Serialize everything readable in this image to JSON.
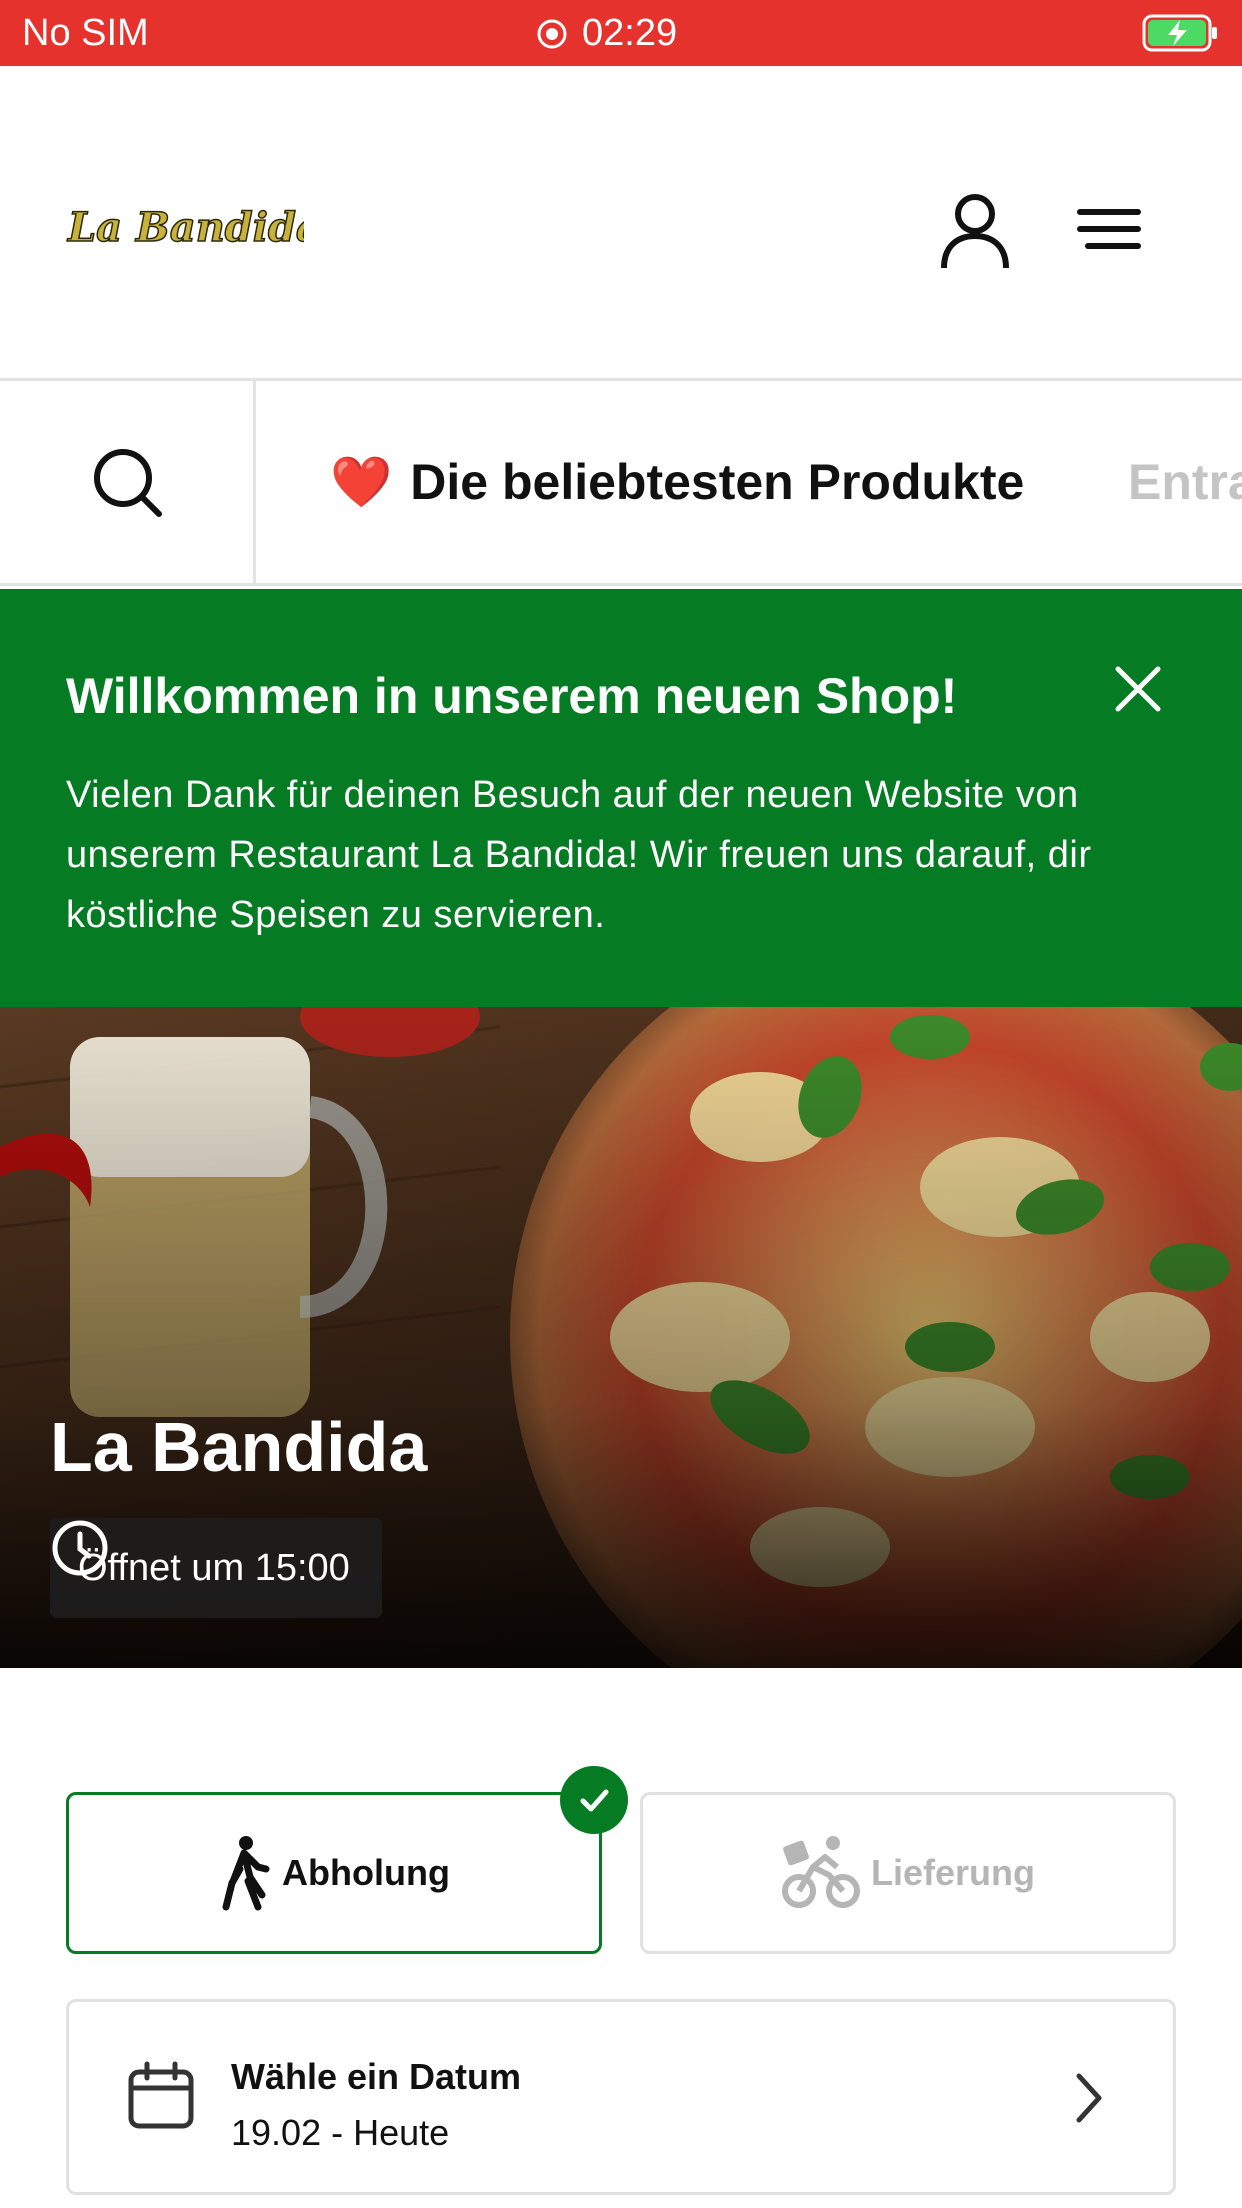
{
  "status_bar": {
    "carrier": "No SIM",
    "time": "02:29",
    "background": "#e5322c"
  },
  "header": {
    "logo_text": "La Bandida",
    "icons": [
      "user-icon",
      "hamburger-menu-icon"
    ]
  },
  "category_nav": {
    "search_icon": "search-icon",
    "categories": [
      {
        "emoji": "❤️",
        "label": "Die beliebtesten Produkte",
        "active": true
      },
      {
        "label": "Entra",
        "active": false
      }
    ]
  },
  "welcome_banner": {
    "title": "Willkommen in unserem neuen Shop!",
    "text": "Vielen Dank für deinen Besuch auf der neuen Website von unserem Restaurant La Bandida! Wir freuen uns darauf, dir köstliche Speisen zu servieren.",
    "background": "#057c23"
  },
  "hero": {
    "restaurant_name": "La Bandida",
    "opening_status": "Öffnet um 15:00"
  },
  "order_mode": {
    "pickup_label": "Abholung",
    "delivery_label": "Lieferung",
    "selected": "pickup",
    "accent": "#057c23"
  },
  "date_picker": {
    "title": "Wähle ein Datum",
    "value": "19.02 - Heute"
  }
}
